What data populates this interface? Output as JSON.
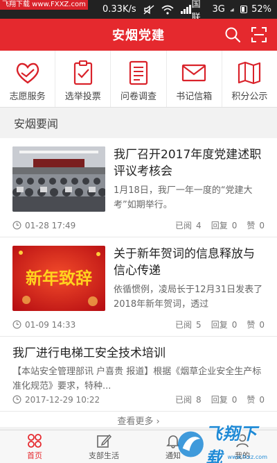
{
  "status_bar": {
    "watermark": "飞翔下载 www.FXXZ.com",
    "speed": "0.33K/s",
    "carrier": "中国联通",
    "network": "3G",
    "battery": "52%"
  },
  "header": {
    "title": "安烟党建"
  },
  "quicknav": [
    {
      "label": "志愿服务",
      "icon": "heart-hands-icon"
    },
    {
      "label": "选举投票",
      "icon": "vote-clipboard-icon"
    },
    {
      "label": "问卷调查",
      "icon": "survey-document-icon"
    },
    {
      "label": "书记信箱",
      "icon": "mail-envelope-icon"
    },
    {
      "label": "积分公示",
      "icon": "map-book-icon"
    }
  ],
  "section": {
    "title": "安烟要闻"
  },
  "news": [
    {
      "title": "我厂召开2017年度党建述职评议考核会",
      "summary": "1月18日，我厂一年一度的“党建大考”如期举行。",
      "date": "01-28 17:49",
      "read_label": "已阅",
      "read": "4",
      "reply_label": "回复",
      "reply": "0",
      "like_label": "赞",
      "like": "0"
    },
    {
      "title": "关于新年贺词的信息释放与信心传递",
      "summary": "依循惯例，凌局长于12月31日发表了2018年新年贺词，透过",
      "date": "01-09 14:33",
      "thumb_text": "新年致辞",
      "read_label": "已阅",
      "read": "5",
      "reply_label": "回复",
      "reply": "0",
      "like_label": "赞",
      "like": "0"
    },
    {
      "title": "我厂进行电梯工安全技术培训",
      "summary": "【本站安全管理部讯 户喜贵 报道】根据《烟草企业安全生产标准化规范》要求，特种...",
      "date": "2017-12-29 10:22",
      "read_label": "已阅",
      "read": "8",
      "reply_label": "回复",
      "reply": "0",
      "like_label": "赞",
      "like": "0"
    }
  ],
  "more": {
    "label": "查看更多 ›"
  },
  "tabbar": [
    {
      "label": "首页",
      "icon": "home-grid-icon",
      "active": true
    },
    {
      "label": "支部生活",
      "icon": "edit-icon",
      "active": false
    },
    {
      "label": "通知",
      "icon": "bell-icon",
      "active": false
    },
    {
      "label": "我的",
      "icon": "user-icon",
      "active": false
    }
  ],
  "watermark": {
    "text": "飞翔下载",
    "url": "www.fxxz.com"
  },
  "colors": {
    "brand_red": "#e5292e",
    "status_bar": "#222222",
    "watermark_blue": "#1f8ad6"
  }
}
